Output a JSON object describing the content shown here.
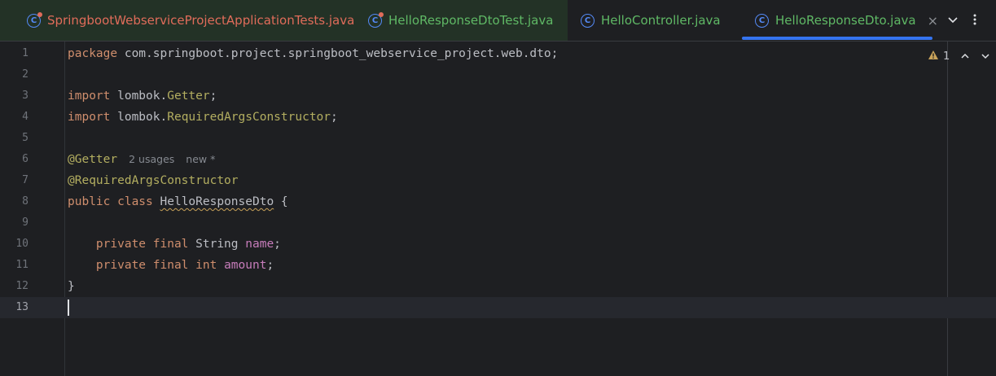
{
  "tabs": [
    {
      "label": "SpringbootWebserviceProjectApplicationTests.java",
      "icon": "java-class-test-icon",
      "status": "red"
    },
    {
      "label": "HelloResponseDtoTest.java",
      "icon": "java-class-test-icon",
      "status": "green"
    },
    {
      "label": "HelloController.java",
      "icon": "java-class-icon",
      "status": "green"
    },
    {
      "label": "HelloResponseDto.java",
      "icon": "java-class-icon",
      "status": "active"
    }
  ],
  "tab_icon_letter": "C",
  "tab_close_glyph": "×",
  "editor": {
    "inspection_count": "1",
    "caret_line": "13",
    "lines": [
      {
        "no": "1"
      },
      {
        "no": "2"
      },
      {
        "no": "3"
      },
      {
        "no": "4"
      },
      {
        "no": "5"
      },
      {
        "no": "6"
      },
      {
        "no": "7"
      },
      {
        "no": "8"
      },
      {
        "no": "9"
      },
      {
        "no": "10"
      },
      {
        "no": "11"
      },
      {
        "no": "12"
      },
      {
        "no": "13"
      }
    ],
    "code": {
      "l1_kw": "package",
      "l1_rest": " com.springboot.project.springboot_webservice_project.web.dto;",
      "l3_kw": "import",
      "l3_pkg": " lombok.",
      "l3_cls": "Getter",
      "l3_end": ";",
      "l4_kw": "import",
      "l4_pkg": " lombok.",
      "l4_cls": "RequiredArgsConstructor",
      "l4_end": ";",
      "l6_ann": "@Getter",
      "l6_hint_usages": "2 usages",
      "l6_hint_new": "new *",
      "l7_ann": "@RequiredArgsConstructor",
      "l8_kw": "public class",
      "l8_name": "HelloResponseDto",
      "l8_end": " {",
      "l10_kw": "    private final",
      "l10_type": " String ",
      "l10_field": "name",
      "l10_end": ";",
      "l11_kw": "    private final int",
      "l11_field": "amount",
      "l11_end": ";",
      "l12": "}"
    }
  },
  "colors": {
    "keyword": "#cf8e6d",
    "annotation": "#b3ae60",
    "field": "#c77dbb",
    "active_tab_underline": "#3574f0"
  }
}
